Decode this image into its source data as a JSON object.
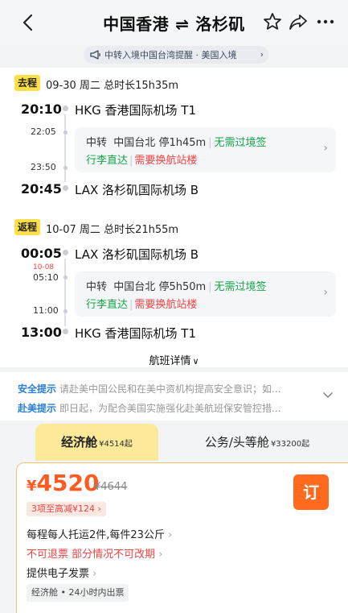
{
  "header": {
    "origin": "中国香港",
    "swap_symbol": "⇌",
    "destination": "洛杉矶"
  },
  "notice": {
    "text": "中转入境中国台湾提醒 · 美国入境",
    "chevron": "›"
  },
  "outbound": {
    "tag": "去程",
    "date": "09-30",
    "weekday": "周二",
    "duration": "总时长15h35m",
    "depart_time": "20:10",
    "depart_airport": "HKG 香港国际机场 T1",
    "layover_arrive": "22:05",
    "layover_depart": "23:50",
    "arrive_time": "20:45",
    "arrive_airport": "LAX 洛杉矶国际机场 B",
    "transfer": {
      "label": "中转",
      "city": "中国台北",
      "stay": "停1h45m",
      "visa": "无需过境签",
      "baggage": "行李直达",
      "terminal": "需要换航站楼"
    }
  },
  "inbound": {
    "tag": "返程",
    "date": "10-07",
    "weekday": "周二",
    "duration": "总时长21h55m",
    "depart_time": "00:05",
    "depart_airport": "LAX 洛杉矶国际机场 B",
    "cross_day": "10-08",
    "layover_arrive": "05:10",
    "layover_depart": "11:00",
    "arrive_time": "13:00",
    "arrive_airport": "HKG 香港国际机场 T1",
    "transfer": {
      "label": "中转",
      "city": "中国台北",
      "stay": "停5h50m",
      "visa": "无需过境签",
      "baggage": "行李直达",
      "terminal": "需要换航站楼"
    }
  },
  "flight_detail": "航班详情",
  "safety": {
    "tip1_label": "安全提示",
    "tip1_text": "请赴美中国公民和在美中资机构提高安全意识；如...",
    "tip2_label": "赴美提示",
    "tip2_text": "即日起，为配合美国实施强化赴美航班保安管控措..."
  },
  "tabs": {
    "economy_name": "经济舱",
    "economy_price": "¥4514起",
    "business_name": "公务/头等舱",
    "business_price": "¥33200起"
  },
  "fare": {
    "currency": "¥",
    "price": "4520",
    "original_price": "¥4644",
    "discount": "3项至高减¥124",
    "book_label": "订",
    "baggage": "每程每人托运2件,每件23公斤",
    "refund": "不可退票  部分情况不可改期",
    "invoice": "提供电子发票",
    "cabin_chip": "经济舱 • 24小时内出票"
  },
  "colors": {
    "accent_orange": "#ff5a1f",
    "tag_yellow": "#fde047",
    "green": "#16a34a",
    "red": "#ef4444",
    "blue": "#2a7fd4"
  }
}
